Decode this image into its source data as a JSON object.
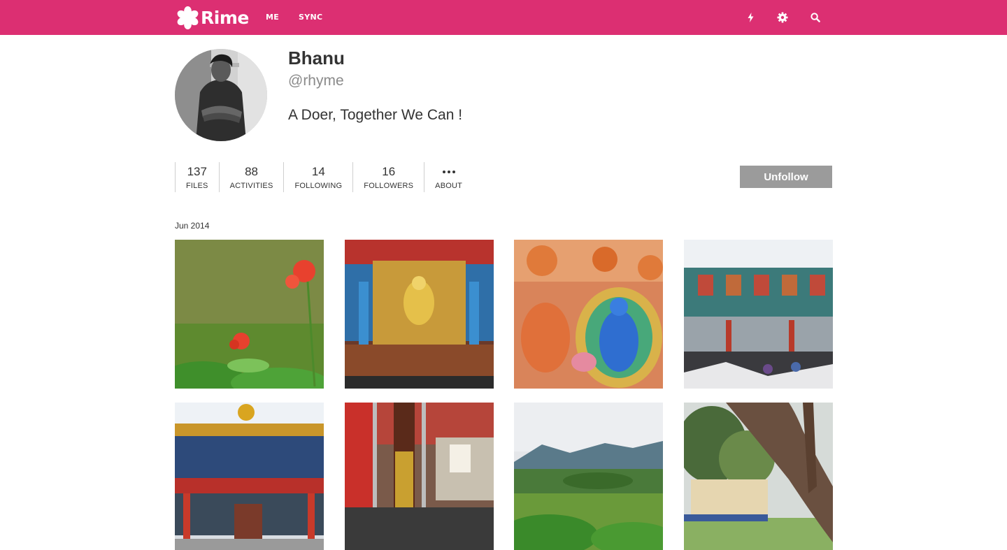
{
  "app": {
    "name": "Rime"
  },
  "nav": {
    "me": "ME",
    "sync": "SYNC"
  },
  "toolbar_icons": [
    "bolt-icon",
    "gear-icon",
    "search-icon"
  ],
  "colors": {
    "brand": "#dc2f72",
    "button_gray": "#9b9b9b"
  },
  "profile": {
    "name": "Bhanu",
    "handle": "@rhyme",
    "bio": "A Doer, Together We Can !"
  },
  "stats": [
    {
      "value": "137",
      "label": "FILES"
    },
    {
      "value": "88",
      "label": "ACTIVITIES"
    },
    {
      "value": "14",
      "label": "FOLLOWING"
    },
    {
      "value": "16",
      "label": "FOLLOWERS"
    },
    {
      "value": "",
      "label": "ABOUT"
    }
  ],
  "actions": {
    "unfollow": "Unfollow"
  },
  "gallery": {
    "date": "Jun 2014",
    "photos": [
      "red-flowers-on-grass",
      "monastery-altar-golden-buddha",
      "thangka-mural-blue-buddha",
      "monastery-hall-interior",
      "monastery-facade-golden-emblem",
      "monastery-glass-door-pillar",
      "green-hills-landscape",
      "tree-trunk-garden"
    ]
  }
}
